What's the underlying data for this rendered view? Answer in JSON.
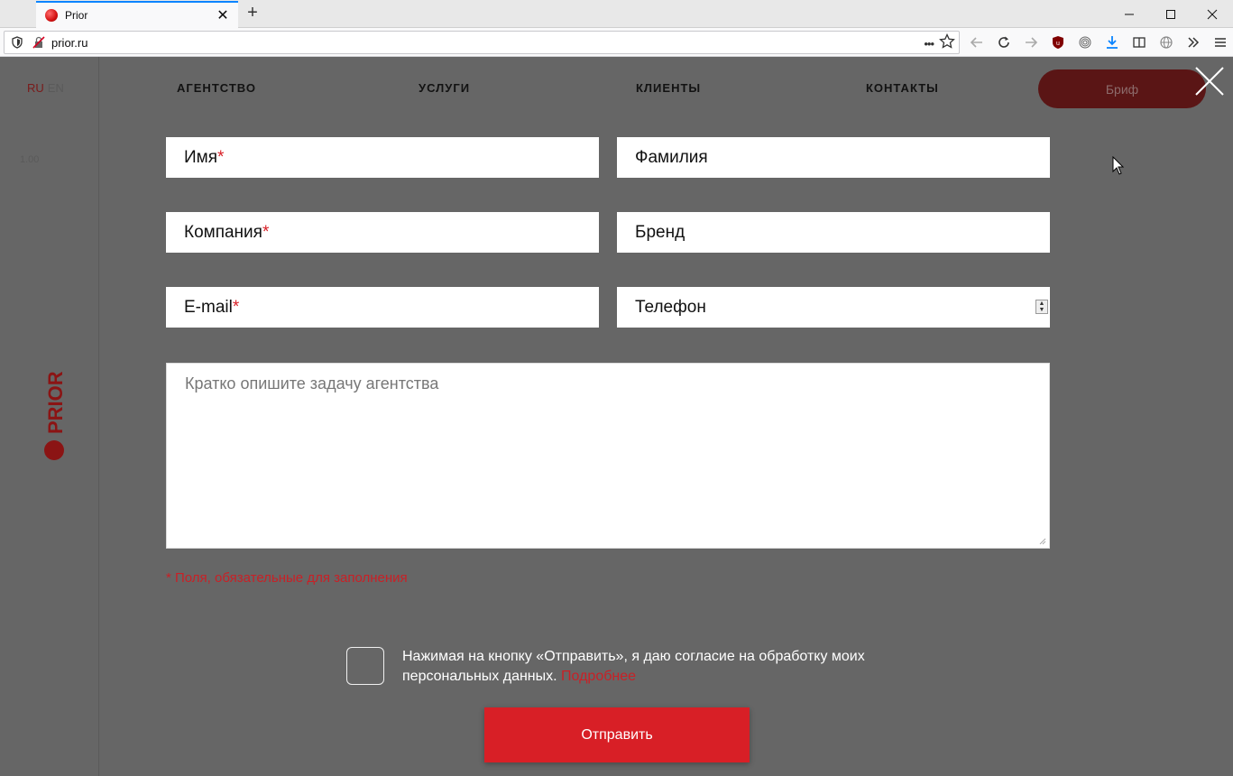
{
  "browser": {
    "tab_title": "Prior",
    "new_tab_symbol": "+",
    "tab_close_symbol": "✕",
    "url": "prior.ru",
    "page_actions_symbol": "•••",
    "accent_color": "#0a84ff"
  },
  "sidebar": {
    "lang_ru": "RU",
    "lang_en": "EN",
    "faint_value": "1.00",
    "logo_text": "PRIOR"
  },
  "nav": {
    "items": [
      {
        "label": "АГЕНТСТВО"
      },
      {
        "label": "УСЛУГИ"
      },
      {
        "label": "КЛИЕНТЫ"
      },
      {
        "label": "КОНТАКТЫ"
      }
    ],
    "brief_label": "Бриф"
  },
  "form": {
    "first_name": "Имя",
    "last_name": "Фамилия",
    "company": "Компания",
    "brand": "Бренд",
    "email": "E-mail",
    "phone": "Телефон",
    "required_mark": "*",
    "message_placeholder": "Кратко опишите задачу агентства",
    "required_note": "* Поля, обязательные для заполнения",
    "consent_text": "Нажимая на кнопку «Отправить», я даю согласие на обработку моих персональных данных.",
    "consent_link": "Подробнее",
    "submit_label": "Отправить"
  },
  "colors": {
    "brand_red": "#d81f26",
    "overlay_gray": "#666666",
    "brief_button": "#5a1515"
  }
}
